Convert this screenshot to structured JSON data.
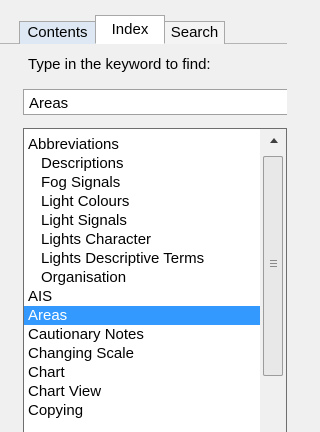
{
  "tabs": [
    {
      "label": "Contents"
    },
    {
      "label": "Index"
    },
    {
      "label": "Search"
    }
  ],
  "prompt_label": "Type in the keyword to find:",
  "search": {
    "value": "Areas"
  },
  "list": {
    "items": [
      {
        "label": "Abbreviations",
        "level": 0
      },
      {
        "label": "Descriptions",
        "level": 1
      },
      {
        "label": "Fog Signals",
        "level": 1
      },
      {
        "label": "Light Colours",
        "level": 1
      },
      {
        "label": "Light Signals",
        "level": 1
      },
      {
        "label": "Lights Character",
        "level": 1
      },
      {
        "label": "Lights Descriptive Terms",
        "level": 1
      },
      {
        "label": "Organisation",
        "level": 1
      },
      {
        "label": "AIS",
        "level": 0
      },
      {
        "label": "Areas",
        "level": 0,
        "selected": true
      },
      {
        "label": "Cautionary Notes",
        "level": 0
      },
      {
        "label": "Changing Scale",
        "level": 0
      },
      {
        "label": "Chart",
        "level": 0
      },
      {
        "label": "Chart View",
        "level": 0
      },
      {
        "label": "Copying",
        "level": 0
      }
    ]
  },
  "colors": {
    "selection": "#3399ff",
    "active_tab": "#ffffff",
    "hover_tab": "#dde8f4"
  }
}
